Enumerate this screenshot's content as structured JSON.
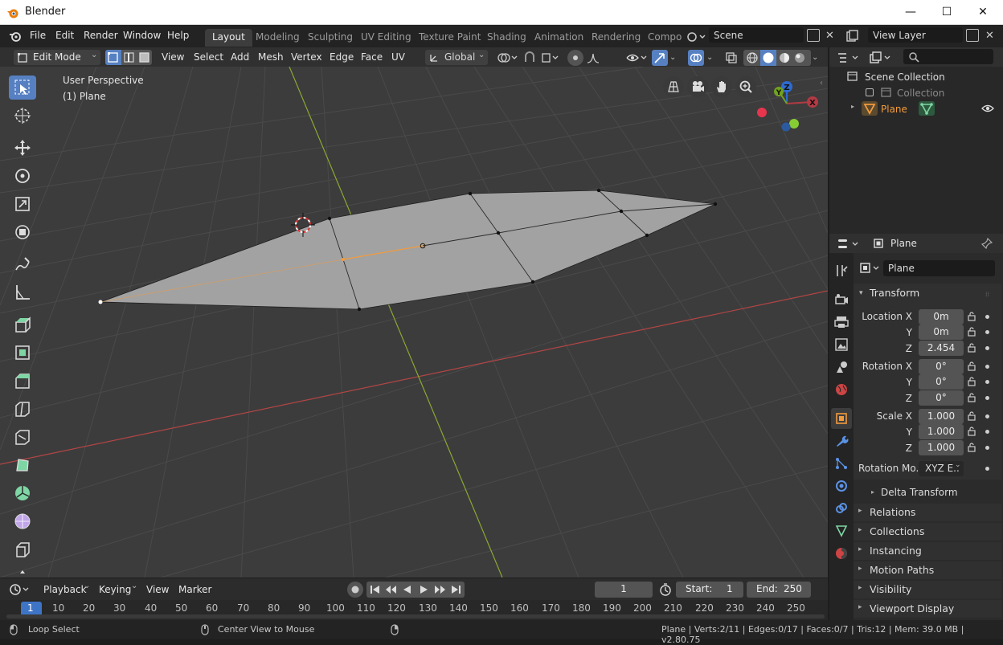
{
  "window": {
    "title": "Blender",
    "minimize": "—",
    "maximize": "☐",
    "close": "✕"
  },
  "menu": [
    "File",
    "Edit",
    "Render",
    "Window",
    "Help"
  ],
  "workspaces": [
    "Layout",
    "Modeling",
    "Sculpting",
    "UV Editing",
    "Texture Paint",
    "Shading",
    "Animation",
    "Rendering",
    "Compo"
  ],
  "scene": {
    "name": "Scene",
    "view_layer": "View Layer"
  },
  "viewport_header": {
    "mode": "Edit Mode",
    "menus": [
      "View",
      "Select",
      "Add",
      "Mesh",
      "Vertex",
      "Edge",
      "Face",
      "UV"
    ],
    "orientation": "Global"
  },
  "viewport": {
    "perspective": "User Perspective",
    "object": "(1) Plane",
    "gizmo": {
      "x": "X",
      "y": "Y",
      "z": "Z"
    }
  },
  "outliner": {
    "root": "Scene Collection",
    "collection": "Collection",
    "object": "Plane"
  },
  "properties": {
    "object_name": "Plane",
    "datablock_name": "Plane",
    "transform_title": "Transform",
    "labels": {
      "location_x": "Location X",
      "y": "Y",
      "z": "Z",
      "rotation_x": "Rotation X",
      "scale_x": "Scale X",
      "rotation_mode": "Rotation Mo.."
    },
    "location": [
      "0m",
      "0m",
      "2.454"
    ],
    "rotation": [
      "0°",
      "0°",
      "0°"
    ],
    "scale": [
      "1.000",
      "1.000",
      "1.000"
    ],
    "rotation_mode": "XYZ E..",
    "delta": "Delta Transform",
    "panels": [
      "Relations",
      "Collections",
      "Instancing",
      "Motion Paths",
      "Visibility",
      "Viewport Display"
    ]
  },
  "timeline": {
    "menus": [
      "Playback",
      "Keying",
      "View",
      "Marker"
    ],
    "current_frame": "1",
    "start_label": "Start:",
    "start": "1",
    "end_label": "End:",
    "end": "250",
    "ruler": [
      "1",
      "10",
      "20",
      "30",
      "40",
      "50",
      "60",
      "70",
      "80",
      "90",
      "100",
      "110",
      "120",
      "130",
      "140",
      "150",
      "160",
      "170",
      "180",
      "190",
      "200",
      "210",
      "220",
      "230",
      "240",
      "250"
    ]
  },
  "status": {
    "left": "Loop Select",
    "mid": "Center View to Mouse",
    "right": "Plane | Verts:2/11 | Edges:0/17 | Faces:0/7 | Tris:12 | Mem: 39.0 MB | v2.80.75"
  },
  "colors": {
    "accent": "#5680c2",
    "x_axis": "#b34545",
    "y_axis": "#8aa832",
    "selected": "#f29b3d"
  }
}
